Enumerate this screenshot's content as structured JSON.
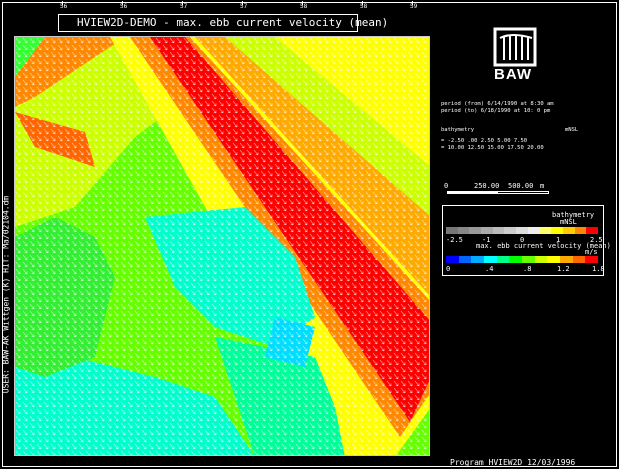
{
  "title": "HVIEW2D-DEMO - max. ebb current velocity (mean)",
  "top_ticks": [
    "56",
    "56",
    "57",
    "57",
    "58",
    "58",
    "59"
  ],
  "side_text": "USER: BAW-AK Wittgen (K)   HIT: Ma/02104.dm",
  "logo_text": "BAW",
  "period": {
    "from": "period (from)  6/14/1990 at  8:30 am",
    "to": "period (to)    6/18/1990 at 10: 0 pm"
  },
  "bathy_table": {
    "header_left": "bathymetry",
    "header_right": "mNSL",
    "row1": "=   -2.50  .00   2.50  5.00   7.50",
    "row2": "=   10.00 12.50  15.00 17.50  20.00"
  },
  "scale": {
    "labels": [
      "0",
      "250.00",
      "500.00",
      "m"
    ]
  },
  "bathymetry_legend": {
    "title": "bathymetry",
    "unit": "mNSL",
    "ticks": [
      "-2.5",
      "-1",
      "0",
      "1",
      "2.5"
    ],
    "colors": [
      "#777777",
      "#888888",
      "#999999",
      "#aaaaaa",
      "#bbbbbb",
      "#cccccc",
      "#dddddd",
      "#eeeeee",
      "#ffff66",
      "#ffff00",
      "#ffcc00",
      "#ff8800",
      "#ff0000"
    ]
  },
  "velocity_legend": {
    "title": "max. ebb current velocity (mean)",
    "unit": "m/s",
    "ticks": [
      ".0",
      ".4",
      ".8",
      "1.2",
      "1.8"
    ],
    "tick0": "0",
    "colors": [
      "#0000ff",
      "#0066ff",
      "#00aaff",
      "#00ffff",
      "#00ff88",
      "#00ff00",
      "#66ff00",
      "#ccff00",
      "#ffff00",
      "#ffaa00",
      "#ff6600",
      "#ff0000"
    ]
  },
  "footer": "Program  HVIEW2D      12/03/1996"
}
